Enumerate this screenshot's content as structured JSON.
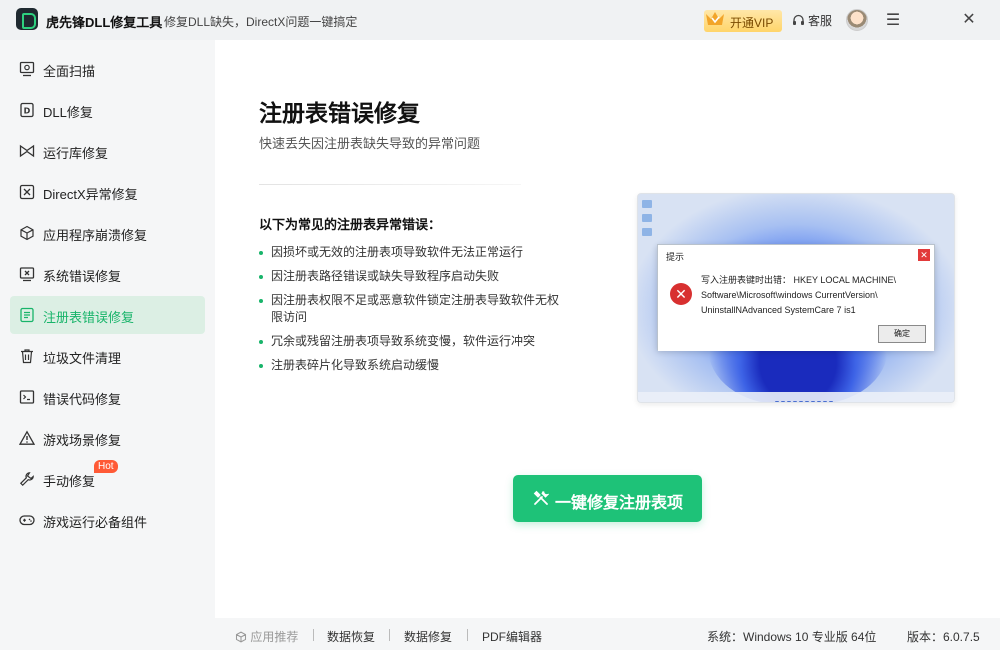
{
  "titlebar": {
    "app_title": "虎先锋DLL修复工具",
    "slogan": "修复DLL缺失，DirectX问题一键搞定",
    "vip_label": "开通VIP",
    "service_label": "客服",
    "menu_glyph": "☰",
    "close_glyph": "✕"
  },
  "sidebar": {
    "items": [
      {
        "label": "全面扫描",
        "icon": "scan-icon"
      },
      {
        "label": "DLL修复",
        "icon": "dll-icon"
      },
      {
        "label": "运行库修复",
        "icon": "runtime-icon"
      },
      {
        "label": "DirectX异常修复",
        "icon": "directx-icon"
      },
      {
        "label": "应用程序崩溃修复",
        "icon": "cube-icon"
      },
      {
        "label": "系统错误修复",
        "icon": "system-error-icon"
      },
      {
        "label": "注册表错误修复",
        "icon": "registry-icon"
      },
      {
        "label": "垃圾文件清理",
        "icon": "trash-icon"
      },
      {
        "label": "错误代码修复",
        "icon": "terminal-icon"
      },
      {
        "label": "游戏场景修复",
        "icon": "warning-icon"
      },
      {
        "label": "手动修复",
        "icon": "wrench-icon"
      },
      {
        "label": "游戏运行必备组件",
        "icon": "gamepad-icon"
      }
    ],
    "active_index": 6,
    "hot_badge": "Hot"
  },
  "main": {
    "title": "注册表错误修复",
    "subtitle": "快速丢失因注册表缺失导致的异常问题",
    "list_title": "以下为常见的注册表异常错误：",
    "errors": [
      "因损坏或无效的注册表项导致软件无法正常运行",
      "因注册表路径错误或缺失导致程序启动失败",
      "因注册表权限不足或恶意软件锁定注册表导致软件无权限访问",
      "冗余或残留注册表项导致系统变慢，软件运行冲突",
      "注册表碎片化导致系统启动缓慢"
    ],
    "preview": {
      "dialog_title": "提示",
      "dialog_close": "✕",
      "error_glyph": "✕",
      "message_line1": "写入注册表键时出错： HKEY LOCAL MACHINE\\",
      "message_line2": "Software\\Microsoft\\windows CurrentVersion\\",
      "message_line3": "UninstallNAdvanced SystemCare 7 is1",
      "ok_label": "确定"
    },
    "fix_button": "一键修复注册表项"
  },
  "footer": {
    "recommend": "应用推荐",
    "links": [
      "数据恢复",
      "数据修复",
      "PDF编辑器"
    ],
    "system": "系统：Windows 10 专业版 64位",
    "version": "版本：6.0.7.5"
  },
  "colors": {
    "accent": "#1ec278",
    "active_bg": "#dcefe4",
    "hot": "#ff5a36"
  }
}
